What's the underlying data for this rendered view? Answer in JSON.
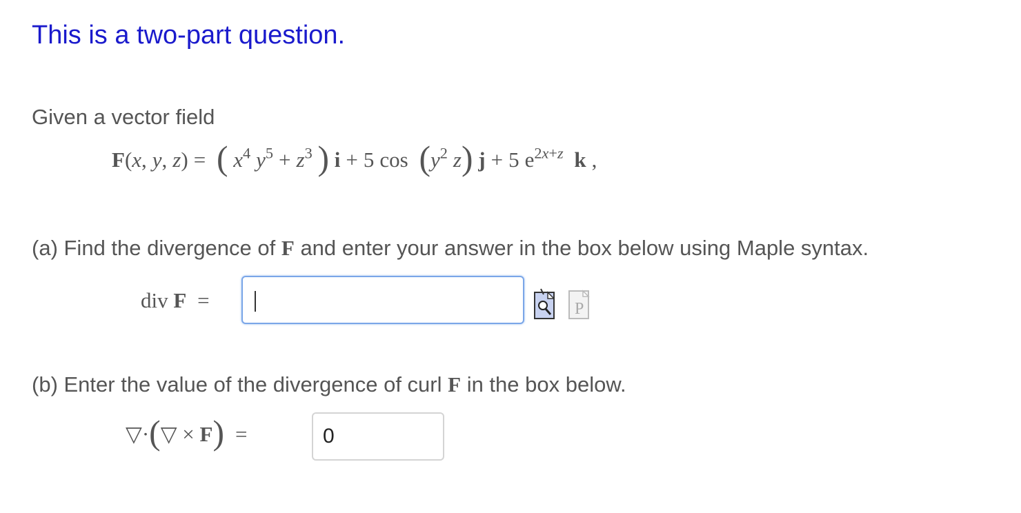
{
  "heading": "This is a two-part question.",
  "intro": "Given a vector field",
  "field": {
    "lhs": "F(x, y, z) =",
    "i_term": "x4 y5 + z3",
    "i_unit": "i",
    "j_coef": "5 cos",
    "j_arg": "y2 z",
    "j_unit": "j",
    "k_coef": "5 e",
    "k_exp": "2x+z",
    "k_unit": "k"
  },
  "part_a": {
    "prefix": "(a) Find the divergence of",
    "symbol": "F",
    "suffix": "and enter your answer in the box below using Maple syntax.",
    "label_text": "div",
    "label_symbol": "F",
    "equals": "=",
    "input_value": "",
    "icons": [
      "preview-icon",
      "p-icon"
    ]
  },
  "part_b": {
    "prefix": "(b) Enter the value of the divergence of curl",
    "symbol": "F",
    "suffix": "in the box below.",
    "label": "∇·(∇×F) =",
    "input_value": "0"
  },
  "colors": {
    "heading": "#1a1acc",
    "text": "#555555",
    "focus_border": "#7aa6e8",
    "input_border": "#d4d4d4"
  }
}
